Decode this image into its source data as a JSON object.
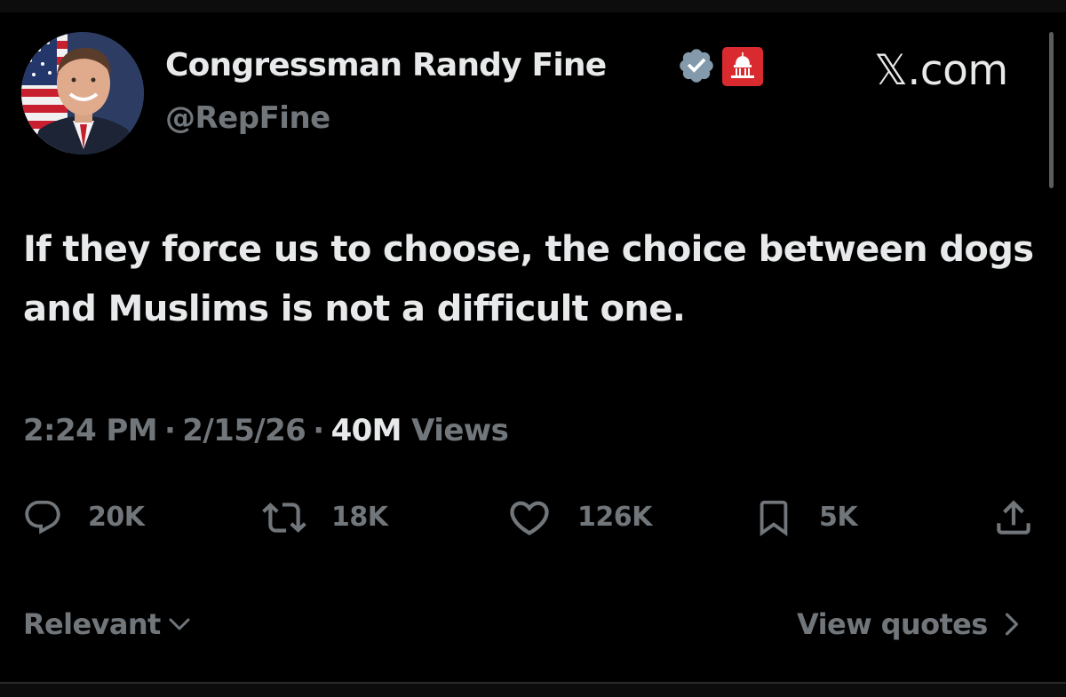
{
  "site": {
    "label": "𝕏.com"
  },
  "author": {
    "display_name": "Congressman Randy Fine",
    "handle": "@RepFine",
    "verified_badge_color": "#829aab",
    "affiliation_badge_color": "#d92b2f"
  },
  "tweet": {
    "text": "If they force us to choose, the choice between dogs and Muslims is not a difficult one.",
    "time": "2:24 PM",
    "date": "2/15/26",
    "views_count": "40M",
    "views_label": "Views",
    "separator": "·"
  },
  "actions": {
    "replies": "20K",
    "reposts": "18K",
    "likes": "126K",
    "bookmarks": "5K"
  },
  "footer": {
    "sort_label": "Relevant",
    "view_quotes_label": "View quotes"
  },
  "icons": {
    "reply": "reply-icon",
    "repost": "repost-icon",
    "like": "heart-icon",
    "bookmark": "bookmark-icon",
    "share": "share-icon",
    "verified": "verified-badge-icon",
    "affiliation": "capitol-badge-icon",
    "sort": "chevron-down-icon",
    "view_quotes": "chevron-right-icon"
  },
  "colors": {
    "background": "#000000",
    "primary_text": "#e7e9ea",
    "secondary_text": "#71767b"
  }
}
